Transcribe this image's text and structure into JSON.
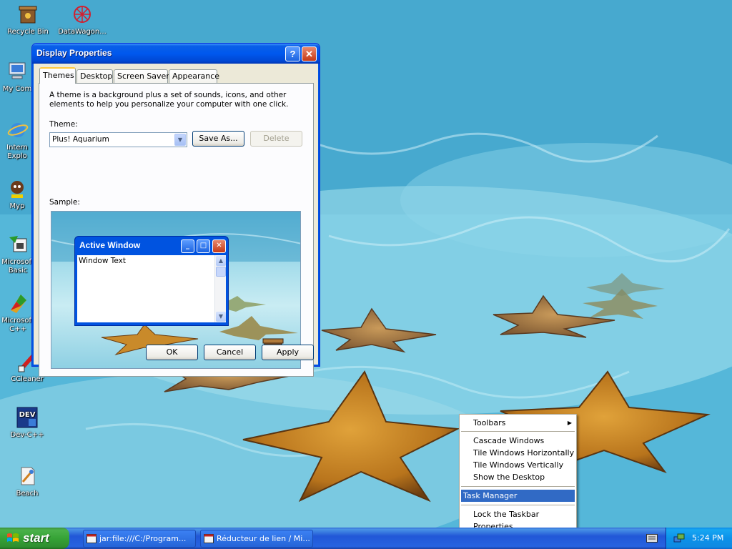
{
  "desktop": {
    "icons": [
      {
        "label": "Recycle Bin",
        "icon": "recycle-bin-icon"
      },
      {
        "label": "DataWagon...",
        "icon": "datawagon-icon"
      },
      {
        "label": "My Com",
        "icon": "my-computer-icon"
      },
      {
        "label": "Intern",
        "label2": "Explo",
        "icon": "internet-explorer-icon"
      },
      {
        "label": "Myp",
        "icon": "myp-icon"
      },
      {
        "label": "Microsoft",
        "label2": "Basic",
        "icon": "visual-basic-icon"
      },
      {
        "label": "Microsoft",
        "label2": "C++",
        "icon": "visual-cpp-icon"
      },
      {
        "label": "CCleaner",
        "icon": "ccleaner-icon"
      },
      {
        "label": "Dev-C++",
        "icon": "dev-cpp-icon"
      },
      {
        "label": "Beach",
        "icon": "beach-file-icon"
      }
    ]
  },
  "dialog": {
    "title": "Display Properties",
    "help_glyph": "?",
    "close_glyph": "✕",
    "tabs": [
      {
        "label": "Themes",
        "active": true
      },
      {
        "label": "Desktop",
        "active": false
      },
      {
        "label": "Screen Saver",
        "active": false
      },
      {
        "label": "Appearance",
        "active": false
      }
    ],
    "description": "A theme is a background plus a set of sounds, icons, and other elements to help you personalize your computer with one click.",
    "theme_label": "Theme:",
    "theme_value": "Plus! Aquarium",
    "save_as_label": "Save As...",
    "delete_label": "Delete",
    "sample_label": "Sample:",
    "sample": {
      "window_title": "Active Window",
      "window_text": "Window Text",
      "min_glyph": "_",
      "max_glyph": "□",
      "close_glyph": "✕"
    },
    "ok_label": "OK",
    "cancel_label": "Cancel",
    "apply_label": "Apply"
  },
  "context_menu": {
    "items": [
      {
        "label": "Toolbars",
        "submenu": true
      },
      {
        "label": "Cascade Windows"
      },
      {
        "label": "Tile Windows Horizontally"
      },
      {
        "label": "Tile Windows Vertically"
      },
      {
        "label": "Show the Desktop"
      },
      {
        "label": "Task Manager",
        "selected": true
      },
      {
        "label": "Lock the Taskbar"
      },
      {
        "label": "Properties"
      }
    ]
  },
  "taskbar": {
    "start_label": "start",
    "tasks": [
      {
        "label": "jar:file:///C:/Program..."
      },
      {
        "label": "Réducteur de lien / Mi..."
      }
    ],
    "clock": "5:24 PM"
  },
  "colors": {
    "titlebar_blue": "#0058ee",
    "menu_highlight": "#316ac5",
    "start_green": "#36a336",
    "taskbar_blue": "#2157d7"
  }
}
